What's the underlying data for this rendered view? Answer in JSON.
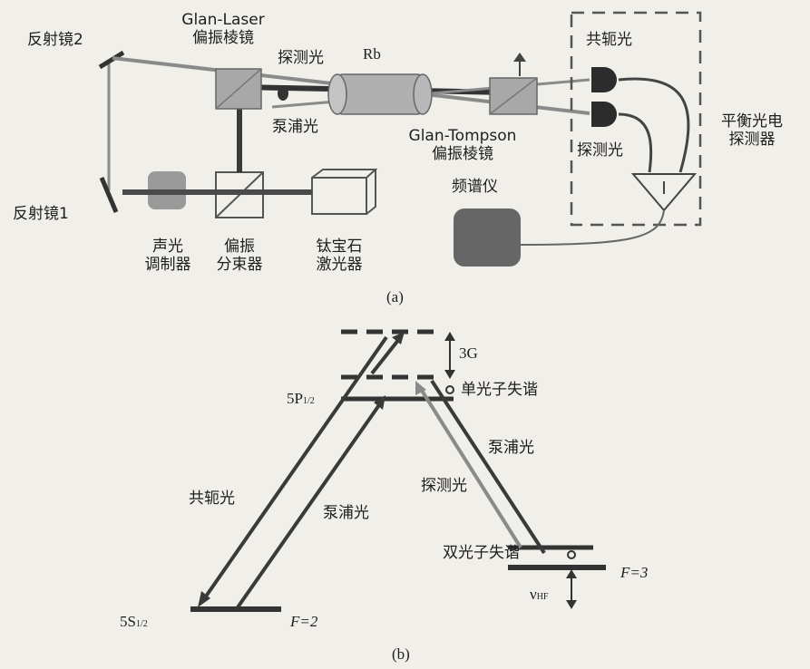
{
  "part_a": {
    "caption": "(a)",
    "mirror2": "反射镜2",
    "mirror1": "反射镜1",
    "glan_laser": [
      "Glan-Laser",
      "偏振棱镜"
    ],
    "probe_top": "探测光",
    "rb": "Rb",
    "pump": "泵浦光",
    "glan_tompson": [
      "Glan-Tompson",
      "偏振棱镜"
    ],
    "spectrometer": "频谱仪",
    "conjugate": "共轭光",
    "probe_det": "探测光",
    "balanced": [
      "平衡光电",
      "探测器"
    ],
    "aom": [
      "声光",
      "调制器"
    ],
    "pbs": [
      "偏振",
      "分束器"
    ],
    "tisapph": [
      "钛宝石",
      "激光器"
    ]
  },
  "part_b": {
    "caption": "(b)",
    "detuning_3g": "3G",
    "single_photon": "单光子失谐",
    "p_level": "5P",
    "p_sub": "1/2",
    "s_level": "5S",
    "s_sub": "1/2",
    "f2": "F=2",
    "f3": "F=3",
    "conjugate": "共轭光",
    "pump_left": "泵浦光",
    "probe": "探测光",
    "pump_right": "泵浦光",
    "two_photon": "双光子失谐",
    "nu": "ν",
    "nu_sub": "HF"
  },
  "colors": {
    "beam_dark": "#3a3a3a",
    "beam_light": "#8a8a8a",
    "optic_fill": "#a8a8a8",
    "background": "#f1efea"
  }
}
